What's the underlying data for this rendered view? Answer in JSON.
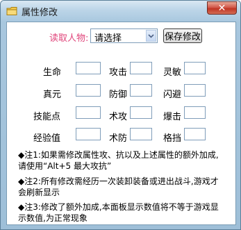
{
  "window": {
    "title": "属性修改",
    "close_label": "✕"
  },
  "toolbar": {
    "character_label": "读取人物:",
    "character_select_value": "请选择",
    "save_label": "保存修改"
  },
  "stats": [
    {
      "label": "生命",
      "value": ""
    },
    {
      "label": "攻击",
      "value": ""
    },
    {
      "label": "灵敏",
      "value": ""
    },
    {
      "label": "真元",
      "value": ""
    },
    {
      "label": "防御",
      "value": ""
    },
    {
      "label": "闪避",
      "value": ""
    },
    {
      "label": "技能点",
      "value": ""
    },
    {
      "label": "术攻",
      "value": ""
    },
    {
      "label": "爆击",
      "value": ""
    },
    {
      "label": "经验值",
      "value": ""
    },
    {
      "label": "术防",
      "value": ""
    },
    {
      "label": "格挡",
      "value": ""
    }
  ],
  "notes": [
    "◆注1:如果需修改属性攻、抗以及上述属性的额外加成,请使用“Alt+5 最大攻抗”",
    "◆注2:所有修改需经历一次装卸装备或进出战斗,游戏才会刷新显示",
    "◆注3:修改了额外加成,本面板显示数值将不等于游戏显示数值,为正常现象"
  ],
  "colors": {
    "character_label": "#e0457b",
    "close_button": "#c7402f",
    "frame": "#a8c7de"
  }
}
